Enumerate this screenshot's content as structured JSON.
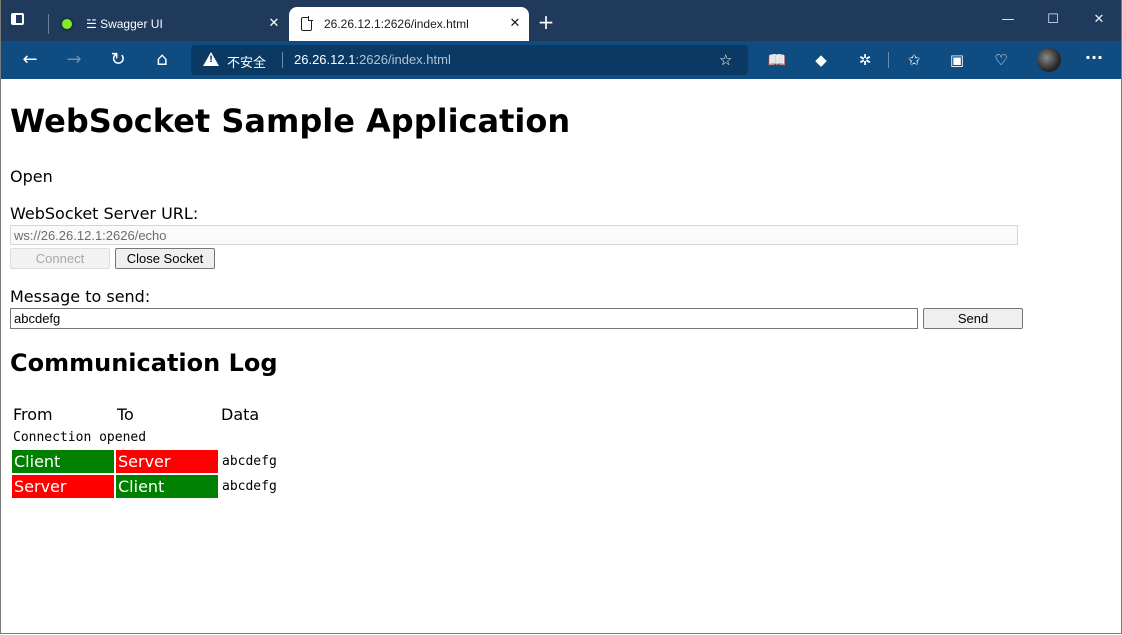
{
  "browser": {
    "tabs": [
      {
        "title": "☱ Swagger UI",
        "close": "✕"
      },
      {
        "title": "26.26.12.1:2626/index.html",
        "close": "✕"
      }
    ],
    "new_tab": "+",
    "window_controls": {
      "minimize": "—",
      "maximize": "☐",
      "close": "✕"
    },
    "nav": {
      "back": "←",
      "forward": "→",
      "refresh": "↻",
      "home": "⌂"
    },
    "address": {
      "security_label": "不安全",
      "url_host": "26.26.12.1",
      "url_rest": ":2626/index.html"
    },
    "toolbar_icons": [
      "read-aloud-icon",
      "extension-shield-icon",
      "puzzle-extensions-icon",
      "favorites-icon",
      "collections-icon",
      "performance-icon",
      "profile-avatar",
      "more-icon"
    ]
  },
  "page": {
    "title": "WebSocket Sample Application",
    "status": "Open",
    "server_url_label": "WebSocket Server URL:",
    "server_url_value": "ws://26.26.12.1:2626/echo",
    "connect_label": "Connect",
    "close_socket_label": "Close Socket",
    "message_label": "Message to send:",
    "message_value": "abcdefg",
    "send_label": "Send",
    "log_title": "Communication Log",
    "log_headers": [
      "From",
      "To",
      "Data"
    ],
    "log_entries": [
      {
        "text": "Connection opened"
      },
      {
        "from": "Client",
        "to": "Server",
        "data": "abcdefg"
      },
      {
        "from": "Server",
        "to": "Client",
        "data": "abcdefg"
      }
    ],
    "colors": {
      "client": "#008000",
      "server": "#ff0000"
    }
  }
}
